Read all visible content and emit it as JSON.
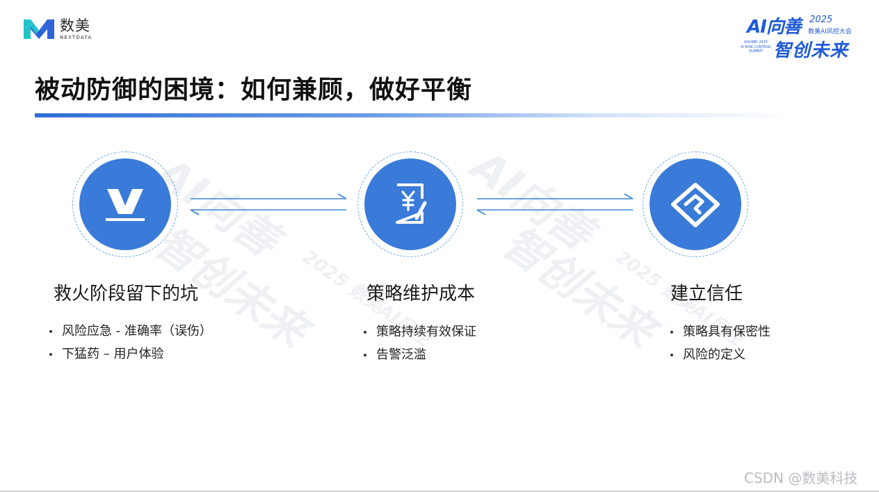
{
  "logo": {
    "cn": "数美",
    "en": "NEXTDATA"
  },
  "badge": {
    "ai": "AI向善",
    "year": "2025",
    "sub": "数美AI风控大会",
    "small": [
      "SHUMEI 2025",
      "AI RISK CONTROL",
      "SUMMIT"
    ],
    "slogan": "智创未来"
  },
  "title": "被动防御的困境：如何兼顾，做好平衡",
  "watermark": {
    "main": "AI向善",
    "slogan": "智创未来",
    "sub": "2025 数美AI风控"
  },
  "columns": [
    {
      "icon": "v-check-icon",
      "heading": "救火阶段留下的坑",
      "bullets": [
        "风险应急 - 准确率（误伤）",
        "下猛药 – 用户体验"
      ]
    },
    {
      "icon": "yuan-document-icon",
      "heading": "策略维护成本",
      "bullets": [
        "策略持续有效保证",
        "告警泛滥"
      ]
    },
    {
      "icon": "handshake-icon",
      "heading": "建立信任",
      "bullets": [
        "策略具有保密性",
        "风险的定义"
      ]
    }
  ],
  "footer": "CSDN @数美科技",
  "colors": {
    "accent": "#3a7bd9",
    "arrow": "#3b86d6",
    "ring": "#6aa6e6",
    "brand_teal": "#22c3c9",
    "brand_blue": "#2f63d8"
  }
}
